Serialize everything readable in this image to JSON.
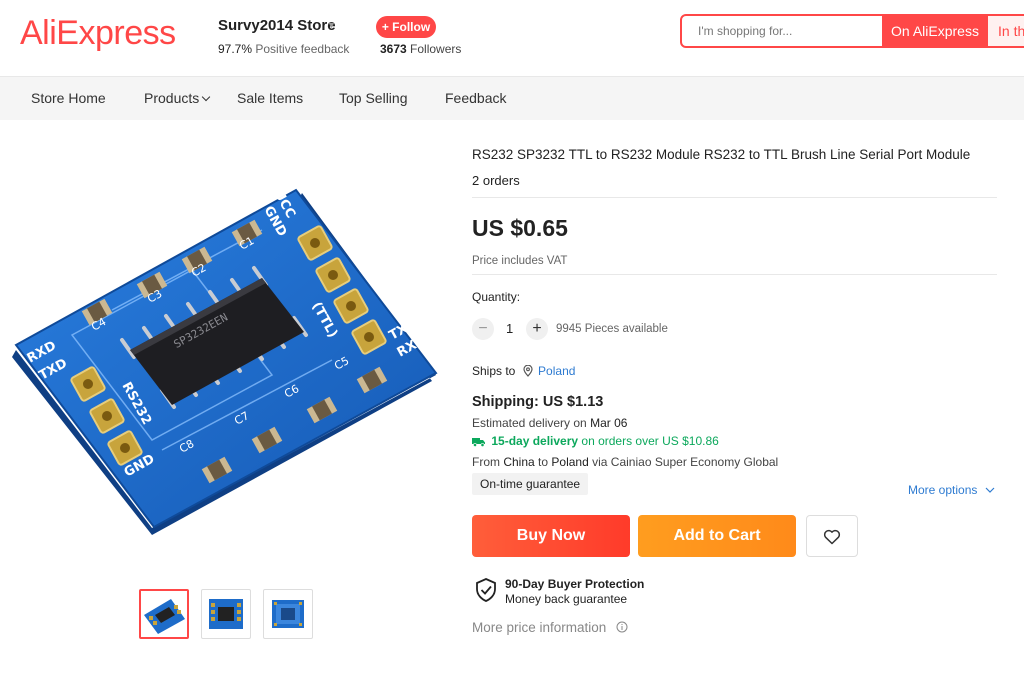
{
  "header": {
    "logo": "AliExpress",
    "store_name": "Survy2014 Store",
    "positive_feedback_value": "97.7%",
    "positive_feedback_label": "Positive feedback",
    "follow_label": "+ Follow",
    "followers_count": "3673",
    "followers_label": "Followers",
    "search_placeholder": "I'm shopping for...",
    "search_button": "On AliExpress",
    "search_button_2": "In th"
  },
  "nav": {
    "items": [
      "Store Home",
      "Products",
      "Sale Items",
      "Top Selling",
      "Feedback"
    ]
  },
  "product": {
    "title": "RS232 SP3232 TTL to RS232 Module RS232 to TTL Brush Line Serial Port Module",
    "orders": "2 orders",
    "price": "US $0.65",
    "vat_note": "Price includes VAT",
    "quantity_label": "Quantity:",
    "quantity_value": "1",
    "qty_minus": "−",
    "qty_plus": "+",
    "pieces_available": "9945 Pieces available",
    "ships_to_label": "Ships to",
    "ships_to_country": "Poland",
    "shipping": "Shipping: US $1.13",
    "est_delivery_label": "Estimated delivery on",
    "est_delivery_date": "Mar 06",
    "fast_delivery_bold": "15-day delivery",
    "fast_delivery_rest": "on orders over US $10.86",
    "from_prefix": "From",
    "from_country": "China",
    "to_word": "to",
    "to_country": "Poland",
    "via": "via Cainiao Super Economy Global",
    "guarantee_badge": "On-time guarantee",
    "more_options": "More options",
    "buy_now": "Buy Now",
    "add_to_cart": "Add to Cart",
    "protection_title": "90-Day Buyer Protection",
    "protection_sub": "Money back guarantee",
    "more_price_info": "More price information"
  },
  "board_labels": {
    "ucc": "UCC",
    "gnd": "GND",
    "txd": "TXD",
    "rxd": "RXD",
    "c1": "C1",
    "c2": "C2",
    "c3": "C3",
    "c4": "C4",
    "c5": "C5",
    "c6": "C6",
    "c7": "C7",
    "c8": "C8",
    "rs232": "RS232",
    "ttl": "(TTL)",
    "chip": "SP3232EEN"
  },
  "colors": {
    "brand": "#ff4747",
    "buy_now": "#ff4b2b",
    "add_to_cart": "#ff951d",
    "link": "#2e7bd1",
    "delivery_green": "#0ca85c",
    "pcb_blue": "#1b68c8"
  }
}
